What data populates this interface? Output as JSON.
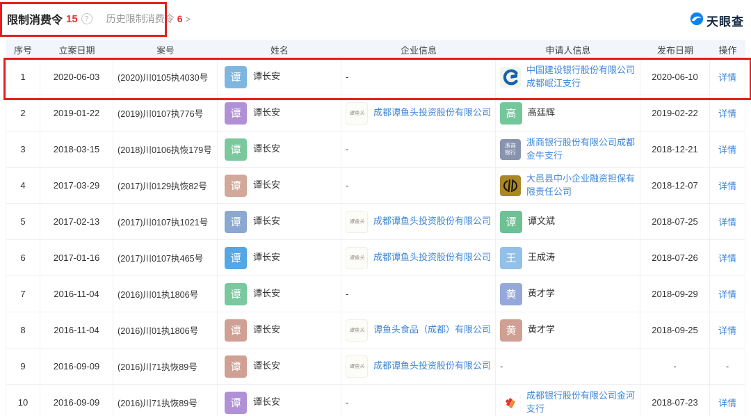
{
  "page": {
    "brand": "天眼查"
  },
  "header": {
    "title": "限制消费令",
    "count": "15",
    "help_glyph": "?",
    "history_label": "历史限制消费令",
    "history_count": "6",
    "chevron": ">"
  },
  "colors": {
    "accent_red": "#e23434",
    "annotation_red": "#e51f1f",
    "link_blue": "#3d86d8",
    "header_bg": "#f2f6fc",
    "brand_blue": "#0b82f0"
  },
  "logo_text": {
    "tanyutou": "谭鱼头",
    "zheshang": [
      "浙商",
      "银行"
    ]
  },
  "table": {
    "columns": [
      "序号",
      "立案日期",
      "案号",
      "姓名",
      "企业信息",
      "申请人信息",
      "发布日期",
      "操作"
    ],
    "rows": [
      {
        "no": "1",
        "filing_date": "2020-06-03",
        "case_no": "(2020)川0105执4030号",
        "name": "谭长安",
        "name_avatar": "谭",
        "name_avatar_color": "#7db7e0",
        "company": "-",
        "applicant": "中国建设银行股份有限公司成都岷江支行",
        "applicant_logo": "ccb",
        "publish_date": "2020-06-10",
        "action": "详情",
        "highlighted": true
      },
      {
        "no": "2",
        "filing_date": "2019-01-22",
        "case_no": "(2019)川0107执776号",
        "name": "谭长安",
        "name_avatar": "谭",
        "name_avatar_color": "#b191d6",
        "company": "成都谭鱼头投资股份有限公司",
        "company_logo": "tanyutou",
        "applicant": "高廷辉",
        "applicant_avatar": "高",
        "applicant_avatar_color": "#74c79b",
        "publish_date": "2019-02-22",
        "action": "详情"
      },
      {
        "no": "3",
        "filing_date": "2018-03-15",
        "case_no": "(2018)川0106执恢179号",
        "name": "谭长安",
        "name_avatar": "谭",
        "name_avatar_color": "#7cc89e",
        "company": "-",
        "applicant": "浙商银行股份有限公司成都金牛支行",
        "applicant_logo": "zheshang",
        "publish_date": "2018-12-21",
        "action": "详情"
      },
      {
        "no": "4",
        "filing_date": "2017-03-29",
        "case_no": "(2017)川0129执恢82号",
        "name": "谭长安",
        "name_avatar": "谭",
        "name_avatar_color": "#d2a89b",
        "company": "-",
        "applicant": "大邑县中小企业融资担保有限责任公司",
        "applicant_logo": "dayi",
        "publish_date": "2018-12-07",
        "action": "详情"
      },
      {
        "no": "5",
        "filing_date": "2017-02-13",
        "case_no": "(2017)川0107执1021号",
        "name": "谭长安",
        "name_avatar": "谭",
        "name_avatar_color": "#8ba8d1",
        "company": "成都谭鱼头投资股份有限公司",
        "company_logo": "tanyutou",
        "applicant": "谭文斌",
        "applicant_avatar": "谭",
        "applicant_avatar_color": "#6ec195",
        "publish_date": "2018-07-25",
        "action": "详情"
      },
      {
        "no": "6",
        "filing_date": "2017-01-16",
        "case_no": "(2017)川0107执465号",
        "name": "谭长安",
        "name_avatar": "谭",
        "name_avatar_color": "#55a6e4",
        "company": "成都谭鱼头投资股份有限公司",
        "company_logo": "tanyutou",
        "applicant": "王成涛",
        "applicant_avatar": "王",
        "applicant_avatar_color": "#92c0e8",
        "publish_date": "2018-07-26",
        "action": "详情"
      },
      {
        "no": "7",
        "filing_date": "2016-11-04",
        "case_no": "(2016)川01执1806号",
        "name": "谭长安",
        "name_avatar": "谭",
        "name_avatar_color": "#79c89e",
        "company": "-",
        "applicant": "黄才学",
        "applicant_avatar": "黄",
        "applicant_avatar_color": "#95a8da",
        "publish_date": "2018-09-29",
        "action": "详情"
      },
      {
        "no": "8",
        "filing_date": "2016-11-04",
        "case_no": "(2016)川01执1806号",
        "name": "谭长安",
        "name_avatar": "谭",
        "name_avatar_color": "#cfa093",
        "company": "谭鱼头食品（成都）有限公司",
        "company_logo": "tanyutou",
        "applicant": "黄才学",
        "applicant_avatar": "黄",
        "applicant_avatar_color": "#cfa093",
        "publish_date": "2018-09-25",
        "action": "详情"
      },
      {
        "no": "9",
        "filing_date": "2016-09-09",
        "case_no": "(2016)川71执恢89号",
        "name": "谭长安",
        "name_avatar": "谭",
        "name_avatar_color": "#cfa093",
        "company": "成都谭鱼头投资股份有限公司",
        "company_logo": "tanyutou",
        "applicant": "-",
        "publish_date": "-",
        "action": "-"
      },
      {
        "no": "10",
        "filing_date": "2016-09-09",
        "case_no": "(2016)川71执恢89号",
        "name": "谭长安",
        "name_avatar": "谭",
        "name_avatar_color": "#b191d6",
        "company": "-",
        "applicant": "成都银行股份有限公司金河支行",
        "applicant_logo": "chengdu",
        "publish_date": "2018-07-23",
        "action": "详情"
      }
    ]
  }
}
